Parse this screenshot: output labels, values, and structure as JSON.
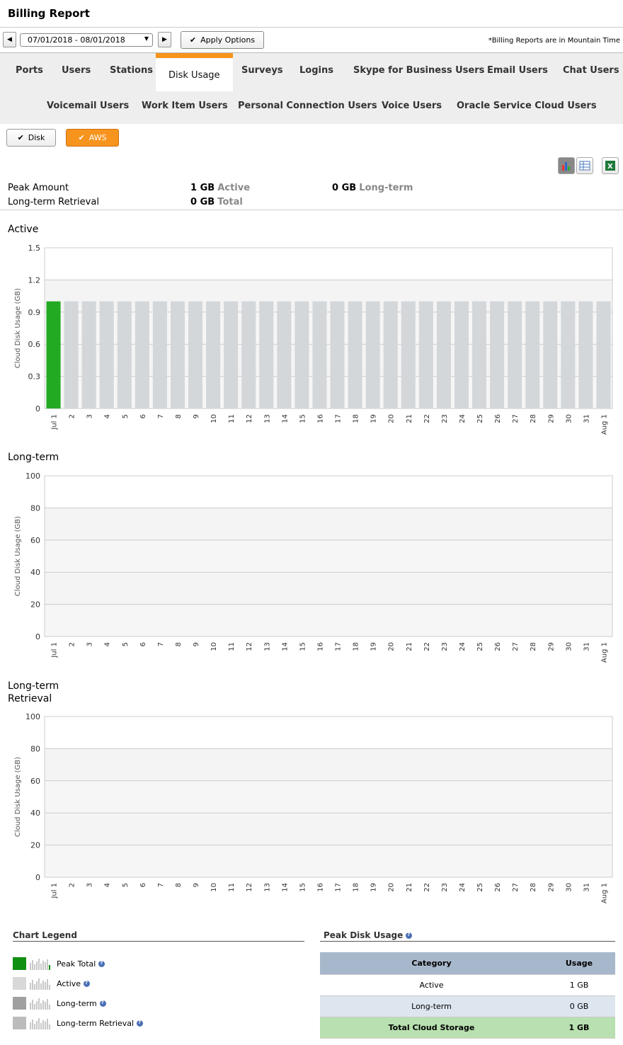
{
  "header": {
    "title": "Billing Report"
  },
  "toolbar": {
    "date_range": "07/01/2018 - 08/01/2018",
    "apply_label": "Apply Options",
    "timezone_note": "*Billing Reports are in Mountain Time"
  },
  "tabs": {
    "row1": [
      "Ports",
      "Users",
      "Stations",
      "Disk Usage",
      "Surveys",
      "Logins",
      "Skype for Business Users",
      "Email Users",
      "Chat Users"
    ],
    "row2": [
      "Voicemail Users",
      "Work Item Users",
      "Personal Connection Users",
      "Voice Users",
      "Oracle Service Cloud Users"
    ],
    "active": "Disk Usage"
  },
  "toggles": {
    "disk": "Disk",
    "aws": "AWS"
  },
  "summary": {
    "peak_label": "Peak Amount",
    "retrieval_label": "Long-term Retrieval",
    "active_value": "1 GB",
    "active_label": "Active",
    "longterm_value": "0 GB",
    "longterm_label": "Long-term",
    "total_value": "0 GB",
    "total_label": "Total"
  },
  "colors": {
    "accent": "#f7941d",
    "peak": "#22aa22",
    "bar": "#d4d7da"
  },
  "chart_data": [
    {
      "type": "bar",
      "title": "Active",
      "ylabel": "Cloud Disk Usage (GB)",
      "ylim": [
        0,
        1.5
      ],
      "yticks": [
        "0",
        "0.3",
        "0.6",
        "0.9",
        "1.2",
        "1.5"
      ],
      "categories": [
        "Jul 1",
        "2",
        "3",
        "4",
        "5",
        "6",
        "7",
        "8",
        "9",
        "10",
        "11",
        "12",
        "13",
        "14",
        "15",
        "16",
        "17",
        "18",
        "19",
        "20",
        "21",
        "22",
        "23",
        "24",
        "25",
        "26",
        "27",
        "28",
        "29",
        "30",
        "31",
        "Aug 1"
      ],
      "values": [
        1,
        1,
        1,
        1,
        1,
        1,
        1,
        1,
        1,
        1,
        1,
        1,
        1,
        1,
        1,
        1,
        1,
        1,
        1,
        1,
        1,
        1,
        1,
        1,
        1,
        1,
        1,
        1,
        1,
        1,
        1,
        1
      ],
      "highlight_index": 0
    },
    {
      "type": "bar",
      "title": "Long-term",
      "ylabel": "Cloud Disk Usage (GB)",
      "ylim": [
        0,
        100
      ],
      "yticks": [
        "0",
        "20",
        "40",
        "60",
        "80",
        "100"
      ],
      "categories": [
        "Jul 1",
        "2",
        "3",
        "4",
        "5",
        "6",
        "7",
        "8",
        "9",
        "10",
        "11",
        "12",
        "13",
        "14",
        "15",
        "16",
        "17",
        "18",
        "19",
        "20",
        "21",
        "22",
        "23",
        "24",
        "25",
        "26",
        "27",
        "28",
        "29",
        "30",
        "31",
        "Aug 1"
      ],
      "values": [
        0,
        0,
        0,
        0,
        0,
        0,
        0,
        0,
        0,
        0,
        0,
        0,
        0,
        0,
        0,
        0,
        0,
        0,
        0,
        0,
        0,
        0,
        0,
        0,
        0,
        0,
        0,
        0,
        0,
        0,
        0,
        0
      ]
    },
    {
      "type": "bar",
      "title": "Long-term Retrieval",
      "ylabel": "Cloud Disk Usage (GB)",
      "ylim": [
        0,
        100
      ],
      "yticks": [
        "0",
        "20",
        "40",
        "60",
        "80",
        "100"
      ],
      "categories": [
        "Jul 1",
        "2",
        "3",
        "4",
        "5",
        "6",
        "7",
        "8",
        "9",
        "10",
        "11",
        "12",
        "13",
        "14",
        "15",
        "16",
        "17",
        "18",
        "19",
        "20",
        "21",
        "22",
        "23",
        "24",
        "25",
        "26",
        "27",
        "28",
        "29",
        "30",
        "31",
        "Aug 1"
      ],
      "values": [
        0,
        0,
        0,
        0,
        0,
        0,
        0,
        0,
        0,
        0,
        0,
        0,
        0,
        0,
        0,
        0,
        0,
        0,
        0,
        0,
        0,
        0,
        0,
        0,
        0,
        0,
        0,
        0,
        0,
        0,
        0,
        0
      ]
    }
  ],
  "legend": {
    "title": "Chart Legend",
    "items": [
      {
        "label": "Peak Total",
        "color": "#109010"
      },
      {
        "label": "Active",
        "color": "#d8d8d8"
      },
      {
        "label": "Long-term",
        "color": "#a0a0a0"
      },
      {
        "label": "Long-term Retrieval",
        "color": "#bcbcbc"
      }
    ]
  },
  "peak_table": {
    "title": "Peak Disk Usage",
    "headers": [
      "Category",
      "Usage"
    ],
    "rows": [
      {
        "category": "Active",
        "usage": "1 GB"
      },
      {
        "category": "Long-term",
        "usage": "0 GB"
      },
      {
        "category": "Total Cloud Storage",
        "usage": "1 GB"
      }
    ]
  }
}
